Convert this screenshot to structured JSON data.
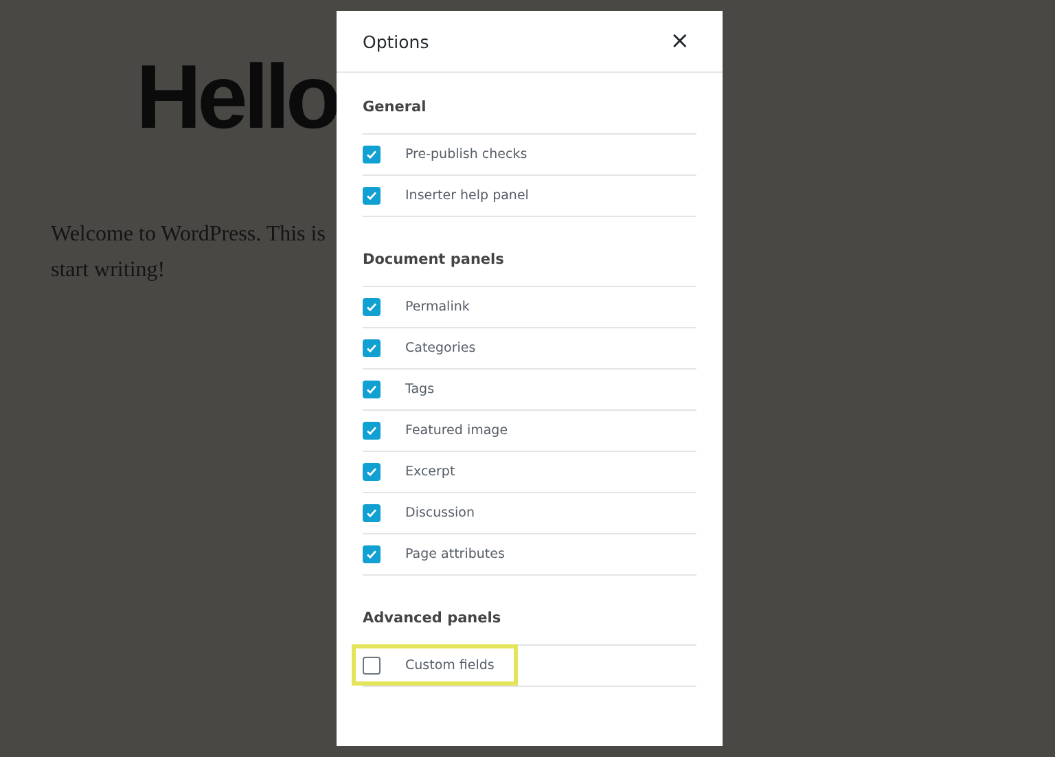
{
  "background": {
    "heading": "Hello",
    "paragraph_lines": [
      "Welcome to WordPress. This is",
      "start writing!"
    ]
  },
  "dialog": {
    "title": "Options",
    "close": "×",
    "sections": [
      {
        "title": "General",
        "items": [
          {
            "label": "Pre-publish checks",
            "checked": true,
            "highlighted": false
          },
          {
            "label": "Inserter help panel",
            "checked": true,
            "highlighted": false
          }
        ]
      },
      {
        "title": "Document panels",
        "items": [
          {
            "label": "Permalink",
            "checked": true,
            "highlighted": false
          },
          {
            "label": "Categories",
            "checked": true,
            "highlighted": false
          },
          {
            "label": "Tags",
            "checked": true,
            "highlighted": false
          },
          {
            "label": "Featured image",
            "checked": true,
            "highlighted": false
          },
          {
            "label": "Excerpt",
            "checked": true,
            "highlighted": false
          },
          {
            "label": "Discussion",
            "checked": true,
            "highlighted": false
          },
          {
            "label": "Page attributes",
            "checked": true,
            "highlighted": false
          }
        ]
      },
      {
        "title": "Advanced panels",
        "items": [
          {
            "label": "Custom fields",
            "checked": false,
            "highlighted": true
          }
        ]
      }
    ]
  }
}
